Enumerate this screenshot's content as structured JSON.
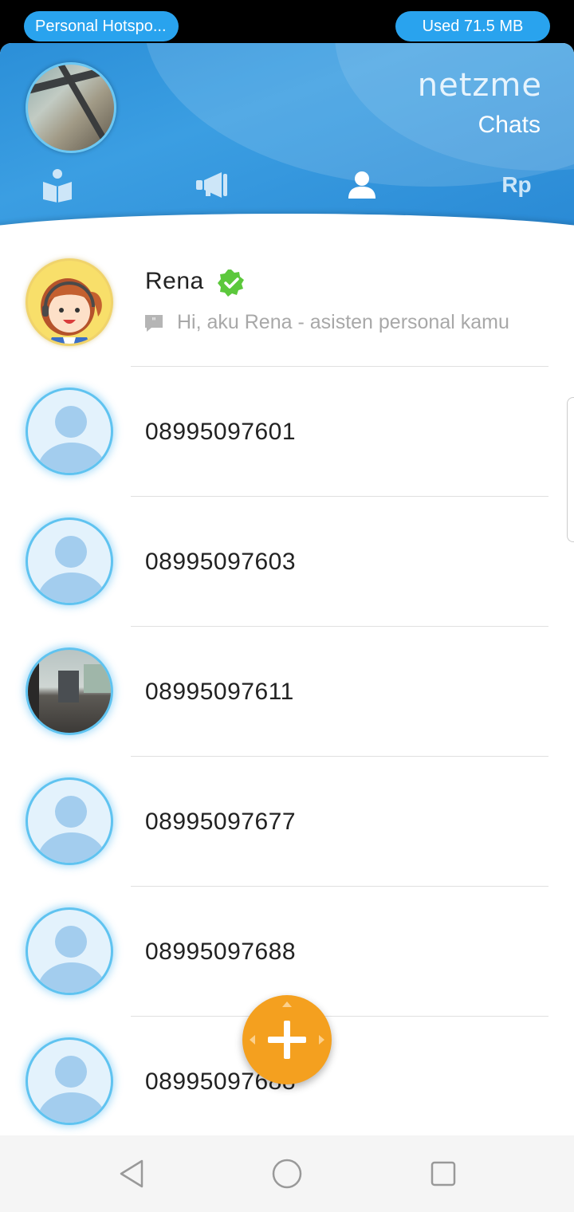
{
  "status_bar": {
    "hotspot_label": "Personal Hotspo...",
    "data_used_label": "Used  71.5 MB"
  },
  "header": {
    "brand": "netzme",
    "section_title": "Chats",
    "tabs": [
      {
        "icon": "book-icon",
        "active": false
      },
      {
        "icon": "megaphone-icon",
        "active": false
      },
      {
        "icon": "person-icon",
        "active": true
      },
      {
        "icon": "rupiah-icon",
        "label": "Rp",
        "active": false
      }
    ]
  },
  "chats": [
    {
      "name": "Rena",
      "verified": true,
      "preview": "Hi, aku Rena - asisten personal kamu",
      "avatar": "assistant-avatar"
    },
    {
      "name": "08995097601",
      "avatar": "default-avatar"
    },
    {
      "name": "08995097603",
      "avatar": "default-avatar"
    },
    {
      "name": "08995097611",
      "avatar": "photo-avatar"
    },
    {
      "name": "08995097677",
      "avatar": "default-avatar"
    },
    {
      "name": "08995097688",
      "avatar": "default-avatar"
    },
    {
      "name": "08995097688",
      "avatar": "default-avatar"
    }
  ],
  "colors": {
    "header_blue": "#3b9ee2",
    "pill_blue": "#29a3ee",
    "fab_orange": "#f4a01f",
    "verified_green": "#5cc83c"
  }
}
